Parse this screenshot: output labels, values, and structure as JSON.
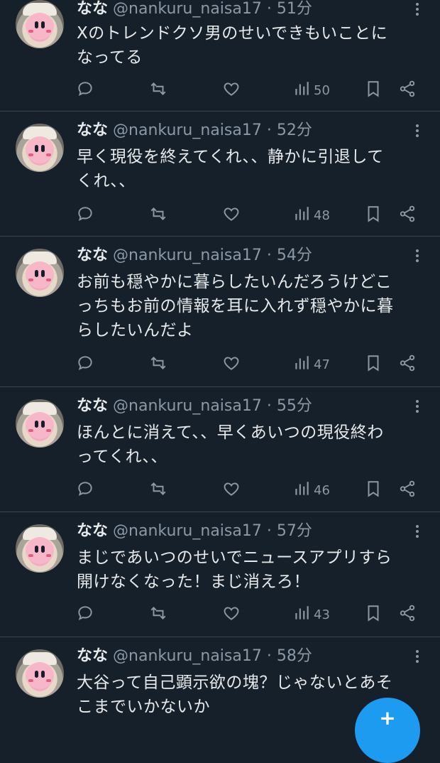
{
  "tweets": [
    {
      "name": "なな",
      "handle": "@nankuru_naisa17",
      "time": "· 51分",
      "text": "Xのトレンドクソ男のせいできもいことに\nなってる",
      "views": "50"
    },
    {
      "name": "なな",
      "handle": "@nankuru_naisa17",
      "time": "· 52分",
      "text": "早く現役を終えてくれ、、静かに引退して\nくれ、、",
      "views": "48"
    },
    {
      "name": "なな",
      "handle": "@nankuru_naisa17",
      "time": "· 54分",
      "text": "お前も穏やかに暮らしたいんだろうけどこ\nっちもお前の情報を耳に入れず穏やかに暮\nらしたいんだよ",
      "views": "47"
    },
    {
      "name": "なな",
      "handle": "@nankuru_naisa17",
      "time": "· 55分",
      "text": "ほんとに消えて、、早くあいつの現役終わ\nってくれ、、",
      "views": "46"
    },
    {
      "name": "なな",
      "handle": "@nankuru_naisa17",
      "time": "· 57分",
      "text": "まじであいつのせいでニュースアプリすら\n開けなくなった！まじ消えろ！",
      "views": "43"
    },
    {
      "name": "なな",
      "handle": "@nankuru_naisa17",
      "time": "· 58分",
      "text": "大谷って自己顕示欲の塊？じゃないとあそ\nこまでいかないか",
      "views": ""
    }
  ],
  "icons": {
    "reply": "reply-icon",
    "retweet": "retweet-icon",
    "like": "like-icon",
    "views": "views-icon",
    "bookmark": "bookmark-icon",
    "share": "share-icon",
    "more": "more-icon"
  },
  "fab_label": "+",
  "colors": {
    "background": "#15202b",
    "text": "#e7e9ea",
    "muted": "#8b98a5",
    "divider": "#38444d",
    "accent": "#1d9bf0"
  }
}
